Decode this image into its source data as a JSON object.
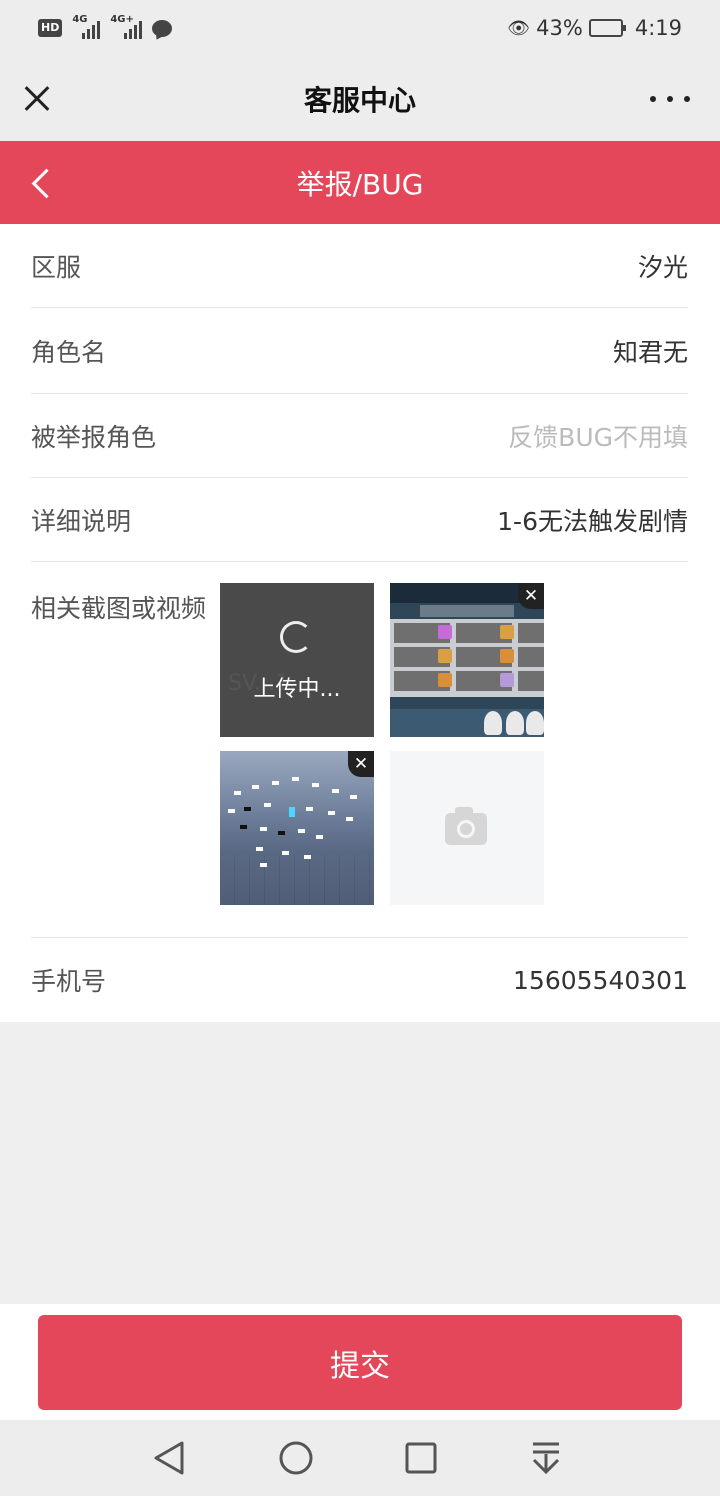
{
  "status_bar": {
    "hd_label": "HD",
    "net1_label": "4G",
    "net2_label": "4G+",
    "battery_percent": "43%",
    "time": "4:19"
  },
  "title_bar": {
    "title": "客服中心",
    "close_icon": "close-icon",
    "more_icon": "more-icon"
  },
  "header": {
    "title": "举报/BUG",
    "back_icon": "chevron-left-icon"
  },
  "form": {
    "server": {
      "label": "区服",
      "value": "汐光"
    },
    "role_name": {
      "label": "角色名",
      "value": "知君无"
    },
    "reported_role": {
      "label": "被举报角色",
      "placeholder": "反馈BUG不用填"
    },
    "details": {
      "label": "详细说明",
      "value": "1-6无法触发剧情"
    },
    "attachments": {
      "label": "相关截图或视频",
      "uploading_text": "上传中...",
      "uploading_filename": "SV...1...",
      "remove_glyph": "✕",
      "add_icon": "camera-icon"
    },
    "phone": {
      "label": "手机号",
      "value": "15605540301"
    }
  },
  "submit": {
    "label": "提交"
  },
  "colors": {
    "accent": "#e5475a",
    "background": "#efefef"
  }
}
